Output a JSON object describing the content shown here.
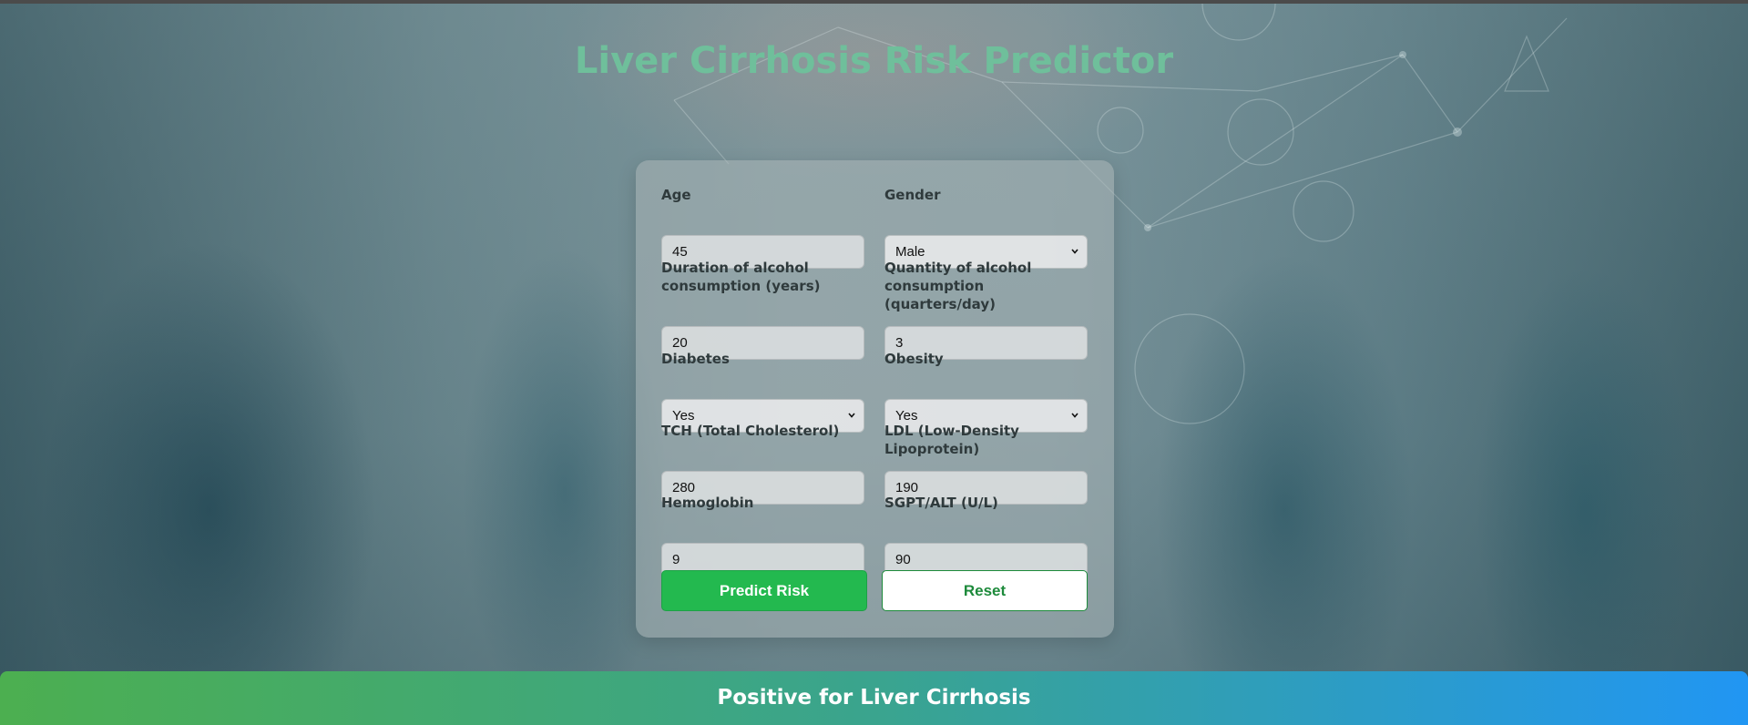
{
  "header": {
    "title": "Liver Cirrhosis Risk Predictor"
  },
  "form": {
    "age": {
      "label": "Age",
      "value": "45"
    },
    "gender": {
      "label": "Gender",
      "value": "Male"
    },
    "duration": {
      "label_line1": "Duration of alcohol",
      "label_line2": "consumption (years)",
      "value": "20"
    },
    "quantity": {
      "label_line1": "Quantity of alcohol",
      "label_line2": "consumption (quarters/day)",
      "value": "3"
    },
    "diabetes": {
      "label": "Diabetes",
      "value": "Yes"
    },
    "obesity": {
      "label": "Obesity",
      "value": "Yes"
    },
    "tch": {
      "label": "TCH (Total Cholesterol)",
      "value": "280"
    },
    "ldl": {
      "label": "LDL (Low-Density Lipoprotein)",
      "value": "190"
    },
    "hemoglobin": {
      "label": "Hemoglobin",
      "value": "9"
    },
    "sgpt": {
      "label": "SGPT/ALT (U/L)",
      "value": "90"
    }
  },
  "buttons": {
    "predict_label": "Predict Risk",
    "reset_label": "Reset"
  },
  "result": {
    "text": "Positive for Liver Cirrhosis"
  },
  "colors": {
    "title": "#6fbf9b",
    "predict_button": "#23b94f",
    "reset_text": "#1d8a3b",
    "result_gradient_start": "#4caf50",
    "result_gradient_end": "#2196f3"
  }
}
